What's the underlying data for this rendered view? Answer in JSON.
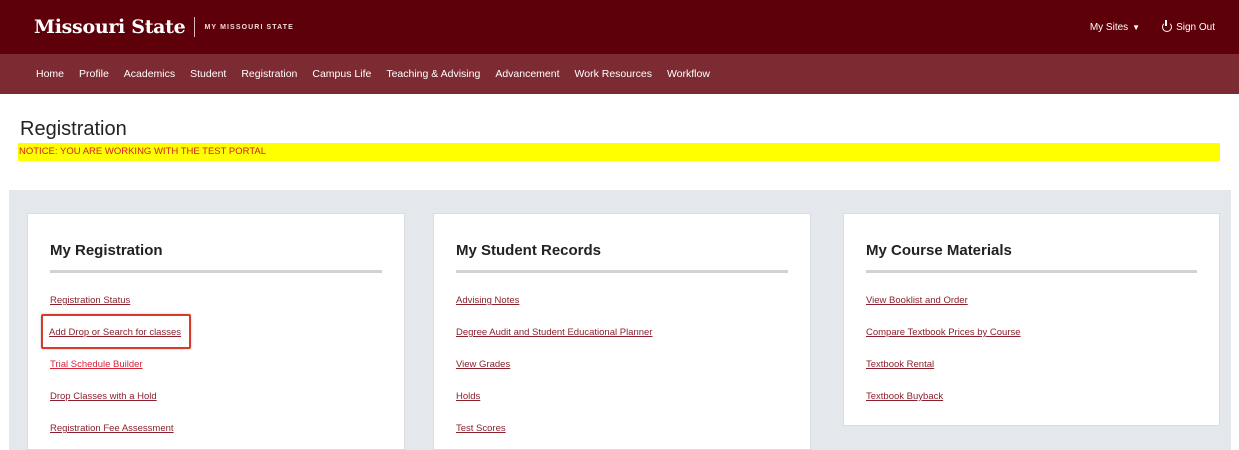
{
  "header": {
    "logo": "Missouri State",
    "sub": "MY MISSOURI STATE",
    "my_sites": "My Sites",
    "sign_out": "Sign Out"
  },
  "nav": [
    "Home",
    "Profile",
    "Academics",
    "Student",
    "Registration",
    "Campus Life",
    "Teaching & Advising",
    "Advancement",
    "Work Resources",
    "Workflow"
  ],
  "page": {
    "title": "Registration",
    "notice": "NOTICE: YOU ARE WORKING WITH THE TEST PORTAL"
  },
  "cards": [
    {
      "title": "My Registration",
      "links": [
        "Registration Status",
        "Add Drop or Search for classes",
        "Trial Schedule Builder",
        "Drop Classes with a Hold",
        "Registration Fee Assessment"
      ]
    },
    {
      "title": "My Student Records",
      "links": [
        "Advising Notes",
        "Degree Audit and Student Educational Planner",
        "View Grades",
        "Holds",
        "Test Scores"
      ]
    },
    {
      "title": "My Course Materials",
      "links": [
        "View Booklist and Order",
        "Compare Textbook Prices by Course",
        "Textbook Rental",
        "Textbook Buyback"
      ]
    }
  ],
  "colors": {
    "header_bg": "#5e0009",
    "nav_bg": "#7d2b33",
    "notice_bg": "#ffff00",
    "notice_text": "#d21f1f",
    "link": "#8c1f2c",
    "highlight_border": "#d83a2b"
  }
}
